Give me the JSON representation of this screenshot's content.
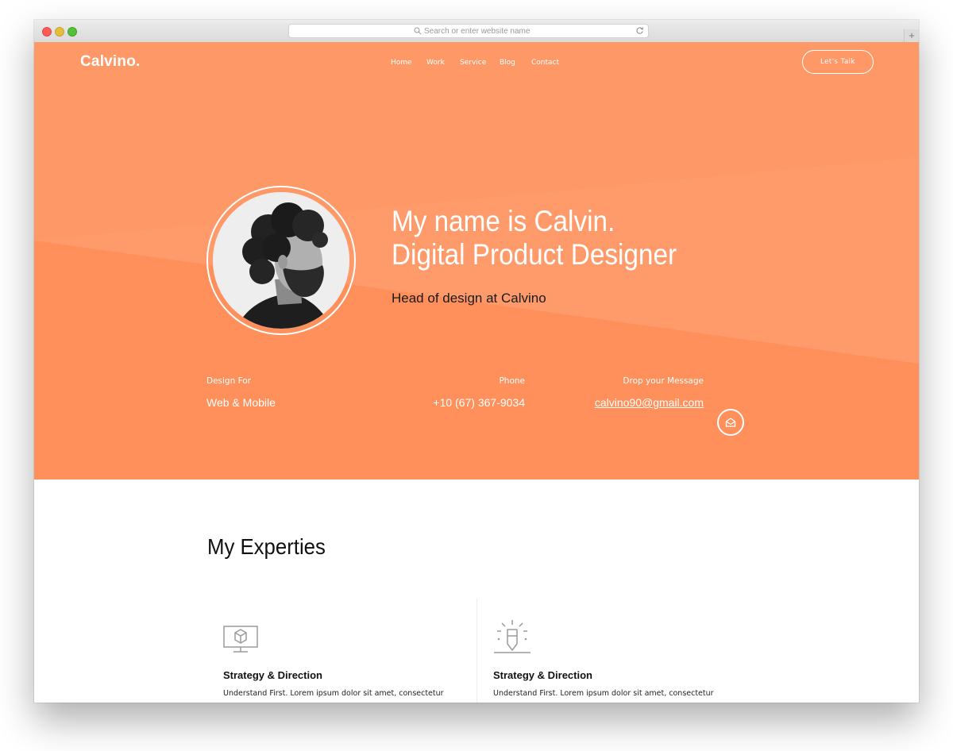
{
  "browser": {
    "url_placeholder": "Search or enter website name",
    "new_tab_label": "+"
  },
  "header": {
    "logo": "Calvino.",
    "nav": [
      "Home",
      "Work",
      "Service",
      "Blog",
      "Contact"
    ],
    "cta": "Let's Talk"
  },
  "hero": {
    "headline_line1": "My name is Calvin.",
    "headline_line2": "Digital Product Designer",
    "subtitle": "Head of design at Calvino",
    "design_label": "Design For",
    "design_value": "Web & Mobile",
    "phone_label": "Phone",
    "phone_value": "+10 (67) 367-9034",
    "message_label": "Drop your Message",
    "email": "calvino90@gmail.com"
  },
  "experties": {
    "title": "My Experties",
    "cards": [
      {
        "title": "Strategy & Direction",
        "text": "Understand First. Lorem ipsum dolor sit amet, consectetur",
        "icon": "monitor-box-icon"
      },
      {
        "title": "Strategy & Direction",
        "text": "Understand First. Lorem ipsum dolor sit amet, consectetur",
        "icon": "pencil-sparkle-icon"
      }
    ]
  },
  "colors": {
    "hero_bg": "#ff9462",
    "text_dark": "#111111"
  }
}
